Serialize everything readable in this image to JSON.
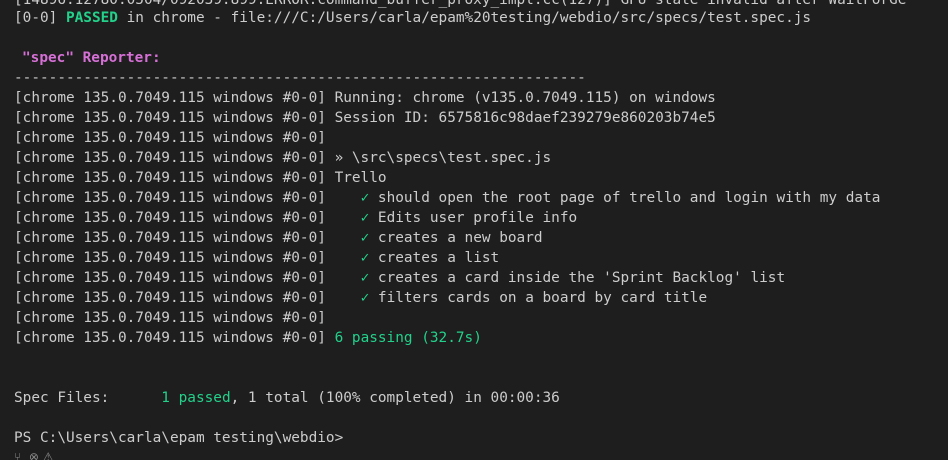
{
  "top_clipped": "[14896:12780:0504/092039.899:ERROR:command_buffer_proxy_impl.cc(127)] GPU state invalid after WaitForGe",
  "passed_line": {
    "prefix": "[0-0] ",
    "status": "PASSED",
    "rest": " in chrome - file:///C:/Users/carla/epam%20testing/webdio/src/specs/test.spec.js"
  },
  "reporter": {
    "name": "\"spec\"",
    "rest": " Reporter:"
  },
  "separator": "------------------------------------------------------------------",
  "log_prefix": "[chrome 135.0.7049.115 windows #0-0]",
  "log_lines": [
    " Running: chrome (v135.0.7049.115) on windows",
    " Session ID: 6575816c98daef239279e860203b74e5",
    "",
    " » \\src\\specs\\test.spec.js",
    " Trello"
  ],
  "checkmark": "✓",
  "tests": [
    "should open the root page of trello and login with my data",
    "Edits user profile info",
    "creates a new board",
    "creates a list",
    "creates a card inside the 'Sprint Backlog' list",
    "filters cards on a board by card title"
  ],
  "summary": "6 passing (32.7s)",
  "spec_files": {
    "label": "Spec Files:",
    "passed": "1 passed",
    "rest": ", 1 total (100% completed) in 00:00:36"
  },
  "prompt": "PS C:\\Users\\carla\\epam testing\\webdio>"
}
